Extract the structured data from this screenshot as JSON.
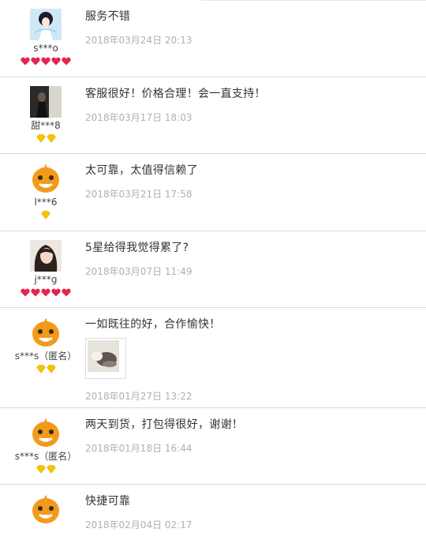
{
  "reviews": [
    {
      "comment": "服务不错",
      "date": "2018年03月24日 20:13",
      "user": "s***o",
      "avatar": "anime-girl",
      "badge": "red-heart",
      "badges": 5
    },
    {
      "comment": "客服很好！价格合理！会一直支持！",
      "date": "2018年03月17日 18:03",
      "user": "甜***8",
      "avatar": "dark-photo",
      "badge": "yellow-diamond",
      "badges": 2
    },
    {
      "comment": "太可靠，太值得信赖了",
      "date": "2018年03月21日 17:58",
      "user": "l***6",
      "avatar": "orange-mascot",
      "badge": "yellow-diamond",
      "badges": 1
    },
    {
      "comment": "5星给得我觉得累了?",
      "date": "2018年03月07日 11:49",
      "user": "j***g",
      "avatar": "girl-photo",
      "badge": "red-heart",
      "badges": 5
    },
    {
      "comment": "一如既往的好，合作愉快！",
      "date": "2018年01月27日 13:22",
      "user": "s***s（匿名）",
      "avatar": "orange-mascot",
      "badge": "yellow-diamond",
      "badges": 2,
      "has_photo": true
    },
    {
      "comment": "两天到货，打包得很好，谢谢！",
      "date": "2018年01月18日 16:44",
      "user": "s***s（匿名）",
      "avatar": "orange-mascot",
      "badge": "yellow-diamond",
      "badges": 2
    },
    {
      "comment": "快捷可靠",
      "date": "2018年02月04日 02:17",
      "user": "",
      "avatar": "orange-mascot",
      "badge": "yellow-diamond",
      "badges": 0
    }
  ],
  "colors": {
    "red_heart": "#e3254f",
    "yellow_diamond": "#f5c400",
    "mascot": "#f39a1a",
    "date_text": "#b0b0b0"
  }
}
